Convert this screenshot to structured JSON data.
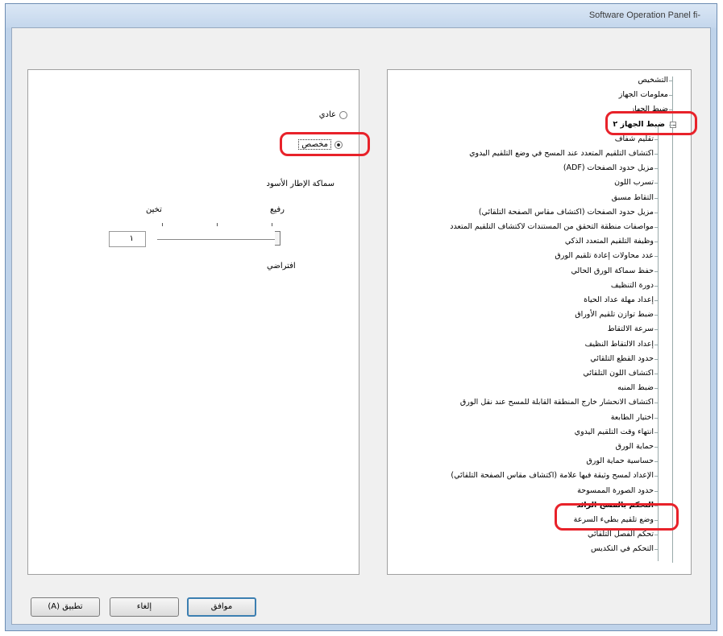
{
  "window": {
    "title": "Software Operation Panel fi-"
  },
  "left_panel": {
    "radio_normal": "عادي",
    "radio_custom": "مخصص",
    "section_title": "سماكة الإطار الأسود",
    "slider_left_label": "تخين",
    "slider_right_label": "رفيع",
    "slider_value": "١",
    "default_label": "افتراضي",
    "selected_option": "custom"
  },
  "tree": {
    "items": [
      "التشخيص",
      "معلومات الجهاز",
      "ضبط الجهاز",
      "ضبط الجهاز ٢",
      "تقليم شفاف",
      "اكتشاف التلقيم المتعدد عند المسح في وضع التلقيم اليدوي",
      "مزيل حدود الصفحات (ADF)",
      "تسرب اللون",
      "التقاط مسبق",
      "مزيل حدود الصفحات (اكتشاف مقاس الصفحة التلقائي)",
      "مواصفات منطقة التحقق من المستندات لاكتشاف التلقيم المتعدد",
      "وظيفة التلقيم المتعدد الذكي",
      "عدد محاولات إعادة تلقيم الورق",
      "حفظ سماكة الورق الحالي",
      "دورة التنظيف",
      "إعداد مهلة عداد الحياة",
      "ضبط توازن تلقيم الأوراق",
      "سرعة الالتقاط",
      "إعداد الالتقاط النظيف",
      "حدود القطع التلقائي",
      "اكتشاف اللون التلقائي",
      "ضبط المنبه",
      "اكتشاف الانحشار خارج المنطقة القابلة للمسح عند نقل الورق",
      "اختيار الطابعة",
      "انتهاء وقت التلقيم اليدوي",
      "حماية الورق",
      "حساسية حماية الورق",
      "الإعداد لمسح وثيقة فيها علامة (اكتشاف مقاس الصفحة التلقائي)",
      "حدود الصورة الممسوحة",
      "التحكم بالمسح الزائد",
      "وضع تلقيم بطيء السرعة",
      "تحكم الفصل التلقائي",
      "التحكم في التكديس"
    ]
  },
  "buttons": {
    "ok": "موافق",
    "cancel": "إلغاء",
    "apply": "تطبيق (A)"
  },
  "colors": {
    "highlight": "#e8222a",
    "window_frame": "#bfd3ea"
  }
}
